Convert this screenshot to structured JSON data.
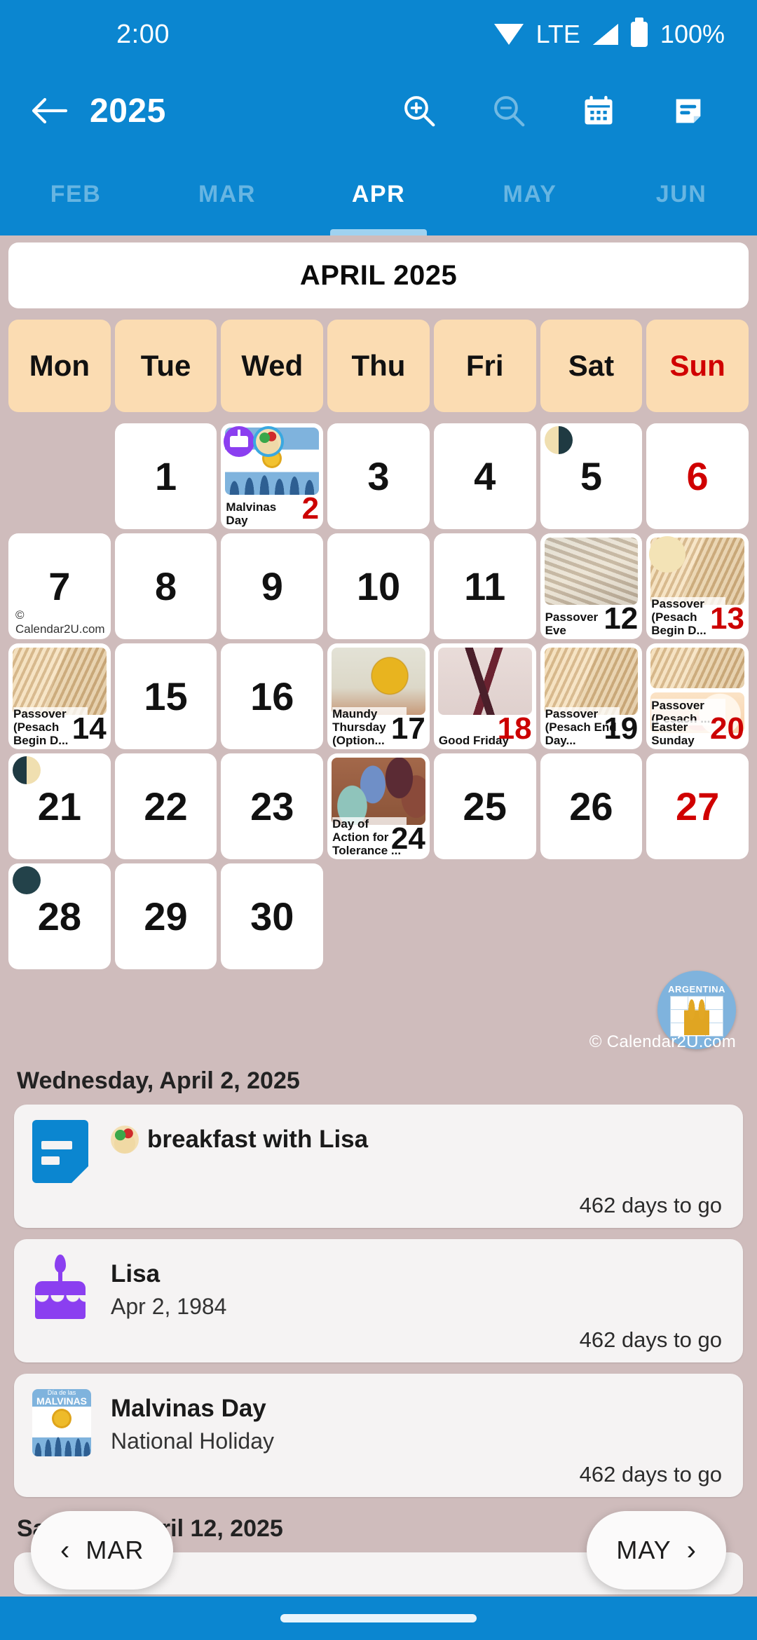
{
  "status_bar": {
    "time": "2:00",
    "network_label": "LTE",
    "battery_label": "100%",
    "icons": [
      "wifi-icon",
      "signal-icon",
      "battery-icon"
    ]
  },
  "app_bar": {
    "back_icon": "back-arrow-icon",
    "title": "2025",
    "actions": [
      {
        "name": "zoom-in-icon",
        "label": "Zoom in",
        "enabled": true
      },
      {
        "name": "zoom-out-icon",
        "label": "Zoom out",
        "enabled": false
      },
      {
        "name": "calendar-icon",
        "label": "Calendar",
        "enabled": true
      },
      {
        "name": "notes-icon",
        "label": "Notes",
        "enabled": true
      }
    ]
  },
  "month_tabs": {
    "items": [
      "FEB",
      "MAR",
      "APR",
      "MAY",
      "JUN"
    ],
    "active": "APR"
  },
  "calendar": {
    "month_title": "APRIL 2025",
    "weekday_headers": [
      "Mon",
      "Tue",
      "Wed",
      "Thu",
      "Fri",
      "Sat",
      "Sun"
    ],
    "watermark": "© Calendar2U.com",
    "cell_watermark": "© Calendar2U.com",
    "country_badge": {
      "label": "ARGENTINA"
    },
    "weeks": [
      [
        {
          "day": ""
        },
        {
          "day": "1"
        },
        {
          "day": "2",
          "red": true,
          "events": [
            "Malvinas Day"
          ],
          "image": "malvinas",
          "badges": [
            "cake-icon",
            "food-icon"
          ]
        },
        {
          "day": "3"
        },
        {
          "day": "4"
        },
        {
          "day": "5",
          "moon": "first-quarter"
        },
        {
          "day": "6",
          "red": true
        }
      ],
      [
        {
          "day": "7",
          "watermark": true
        },
        {
          "day": "8"
        },
        {
          "day": "9"
        },
        {
          "day": "10"
        },
        {
          "day": "11"
        },
        {
          "day": "12",
          "events": [
            "Passover Eve"
          ],
          "image": "matzo2"
        },
        {
          "day": "13",
          "red": true,
          "events": [
            "Passover (Pesach Begin D..."
          ],
          "image": "matzo",
          "moon": "full"
        }
      ],
      [
        {
          "day": "14",
          "events": [
            "Passover (Pesach Begin D..."
          ],
          "image": "matzo"
        },
        {
          "day": "15"
        },
        {
          "day": "16"
        },
        {
          "day": "17",
          "events": [
            "Maundy Thursday (Option..."
          ],
          "image": "cup"
        },
        {
          "day": "18",
          "red": true,
          "events": [
            "Good Friday"
          ],
          "image": "cross"
        },
        {
          "day": "19",
          "events": [
            "Passover (Pesach End Day..."
          ],
          "image": "matzo"
        },
        {
          "day": "20",
          "red": true,
          "events": [
            "Passover (Pesach ...",
            "Easter Sunday"
          ],
          "image": "matzo",
          "image2": "easter"
        }
      ],
      [
        {
          "day": "21",
          "moon": "last-quarter"
        },
        {
          "day": "22"
        },
        {
          "day": "23"
        },
        {
          "day": "24",
          "events": [
            "Day of Action for Tolerance ..."
          ],
          "image": "hands"
        },
        {
          "day": "25"
        },
        {
          "day": "26"
        },
        {
          "day": "27",
          "red": true
        }
      ],
      [
        {
          "day": "28",
          "moon": "new"
        },
        {
          "day": "29"
        },
        {
          "day": "30"
        },
        {
          "day": ""
        },
        {
          "day": ""
        },
        {
          "day": ""
        },
        {
          "day": ""
        }
      ]
    ]
  },
  "event_sections": [
    {
      "date_heading": "Wednesday, April 2, 2025",
      "events": [
        {
          "icon": "note-icon",
          "title": "breakfast with Lisa",
          "emoji": "food-icon",
          "subtitle": "",
          "days_to_go": "462 days to go"
        },
        {
          "icon": "cake-icon",
          "title": "Lisa",
          "subtitle": "Apr 2, 1984",
          "days_to_go": "462 days to go"
        },
        {
          "icon": "argentina-flag-icon",
          "title": "Malvinas Day",
          "subtitle": "National Holiday",
          "days_to_go": "462 days to go"
        }
      ]
    },
    {
      "date_heading": "Saturday, April 12, 2025",
      "events": []
    }
  ],
  "month_nav": {
    "prev_label": "MAR",
    "prev_icon": "chevron-left-icon",
    "next_label": "MAY",
    "next_icon": "chevron-right-icon"
  },
  "colors": {
    "primary": "#0b86d0",
    "background": "#cfbcbc",
    "weekday_header": "#fbdcb2",
    "sunday_red": "#d00000",
    "card": "#f5f3f3"
  }
}
